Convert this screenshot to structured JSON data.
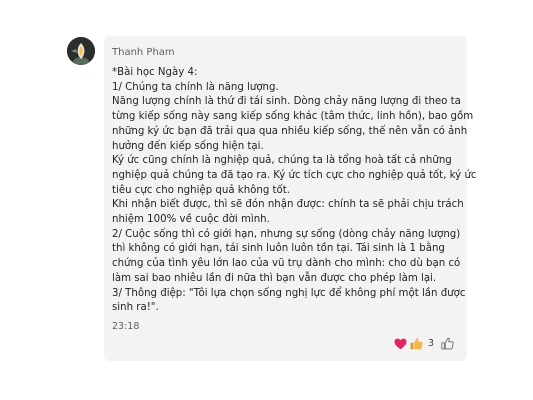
{
  "message": {
    "sender": "Thanh Pham",
    "time": "23:18",
    "lines": [
      "*Bài học Ngày 4:",
      "1/ Chúng ta chính là năng lượng.",
      "Năng lượng chính là thứ đi tái sinh. Dòng chảy năng lượng đi theo ta",
      "từng kiếp sống này sang kiếp sống khác (tâm thức, linh hồn), bao gồm",
      "những ký ức bạn đã trải qua qua nhiều kiếp sống, thế nên vẫn có ảnh",
      "hưởng đến kiếp sống hiện tại.",
      "Ký ức cũng chính là nghiệp quả, chúng ta là tổng hoà tất cả những",
      "nghiệp quả chúng ta đã tạo ra. Ký ức tích cực cho nghiệp quả tốt, ký ức",
      "tiêu cực cho nghiệp quả không tốt.",
      "Khi nhận biết được, thì sẽ đón nhận được: chính ta sẽ phải chịu trách",
      "nhiệm 100% về cuộc đời mình.",
      "2/ Cuộc sống thì có giới hạn, nhưng sự sống (dòng chảy năng lượng)",
      "thì không có giới hạn, tái sinh luôn luôn tồn tại. Tái sinh là 1 bằng",
      "chứng của tình yêu lớn lao của vũ trụ dành cho mình: cho dù bạn có",
      "làm sai bao nhiêu lần đi nữa thì bạn vẫn được cho phép làm lại.",
      "3/ Thông điệp: \"Tôi lựa chọn sống nghị lực để không phí một lần được",
      "sinh ra!\"."
    ]
  },
  "reactions": {
    "icons": [
      "heart-icon",
      "thumbs-up-icon"
    ],
    "count": "3",
    "colors": {
      "heart": "#e0245e",
      "like": "#f2b84b"
    }
  }
}
